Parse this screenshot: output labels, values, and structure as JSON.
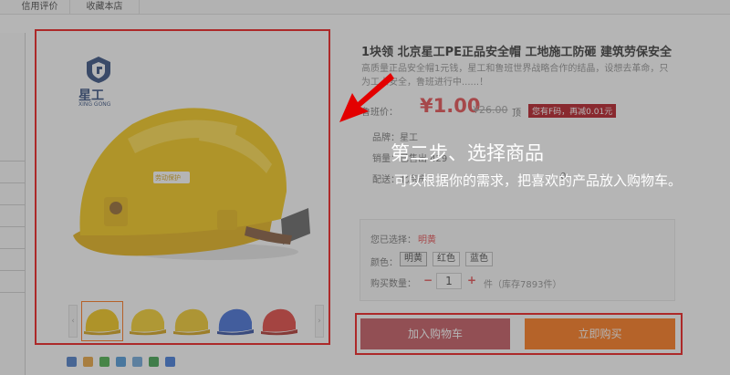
{
  "tabs": [
    "信用评价",
    "收藏本店"
  ],
  "logo": {
    "name": "星工",
    "sub": "XING GONG"
  },
  "helmet_text": "劳动保护",
  "thumbnails": [
    {
      "color": "#f2c200"
    },
    {
      "color": "#f5cb16"
    },
    {
      "color": "#f1c516"
    },
    {
      "color": "#2f5fd3"
    },
    {
      "color": "#e0322d"
    }
  ],
  "thumb_prev": "‹",
  "thumb_next": "›",
  "share_icons": [
    {
      "icon": "plus-icon",
      "color": "#3a6fc4"
    },
    {
      "icon": "qzone-icon",
      "color": "#e89c2a"
    },
    {
      "icon": "wechat-icon",
      "color": "#38a838"
    },
    {
      "icon": "qq-icon",
      "color": "#3b8fd6"
    },
    {
      "icon": "star-icon",
      "color": "#5f9fd8"
    },
    {
      "icon": "douban-icon",
      "color": "#2a9a3c"
    },
    {
      "icon": "weibo-icon",
      "color": "#2c6cd8"
    }
  ],
  "product": {
    "title": "1块领 北京星工PE正品安全帽 工地施工防砸 建筑劳保安全",
    "desc": "高质量正品安全帽1元钱，星工和鲁班世界战略合作的结晶，设想去革命，只为工人安全，鲁班进行中......！",
    "price_label": "鲁班价：",
    "price": "¥1.00",
    "orig_price": "¥26.00",
    "orig_suffix": "顶",
    "coupon": "您有F码，再减0.01元",
    "brand_label": "品牌：",
    "brand": "星工",
    "sales_label": "销量：",
    "sales": "已售出 429",
    "ship_label": "配送：",
    "ship": "北京市",
    "ship_fee": "0"
  },
  "spec": {
    "selected_label": "您已选择：",
    "selected": "明黄",
    "color_label": "颜色：",
    "colors": [
      "明黄",
      "红色",
      "蓝色"
    ],
    "qty_label": "购买数量：",
    "minus": "−",
    "qty": "1",
    "plus": "+",
    "stock": "件（库存7893件）"
  },
  "buttons": {
    "cart": "加入购物车",
    "buy": "立即购买"
  },
  "theme": {
    "cart_bg": "#c0464f",
    "buy_bg": "#ff6a00",
    "price_color": "#e4393c",
    "highlight": "#e00000"
  },
  "guide": {
    "title": "第二步、选择商品",
    "text": "可以根据你的需求，把喜欢的产品放入购物车。"
  }
}
